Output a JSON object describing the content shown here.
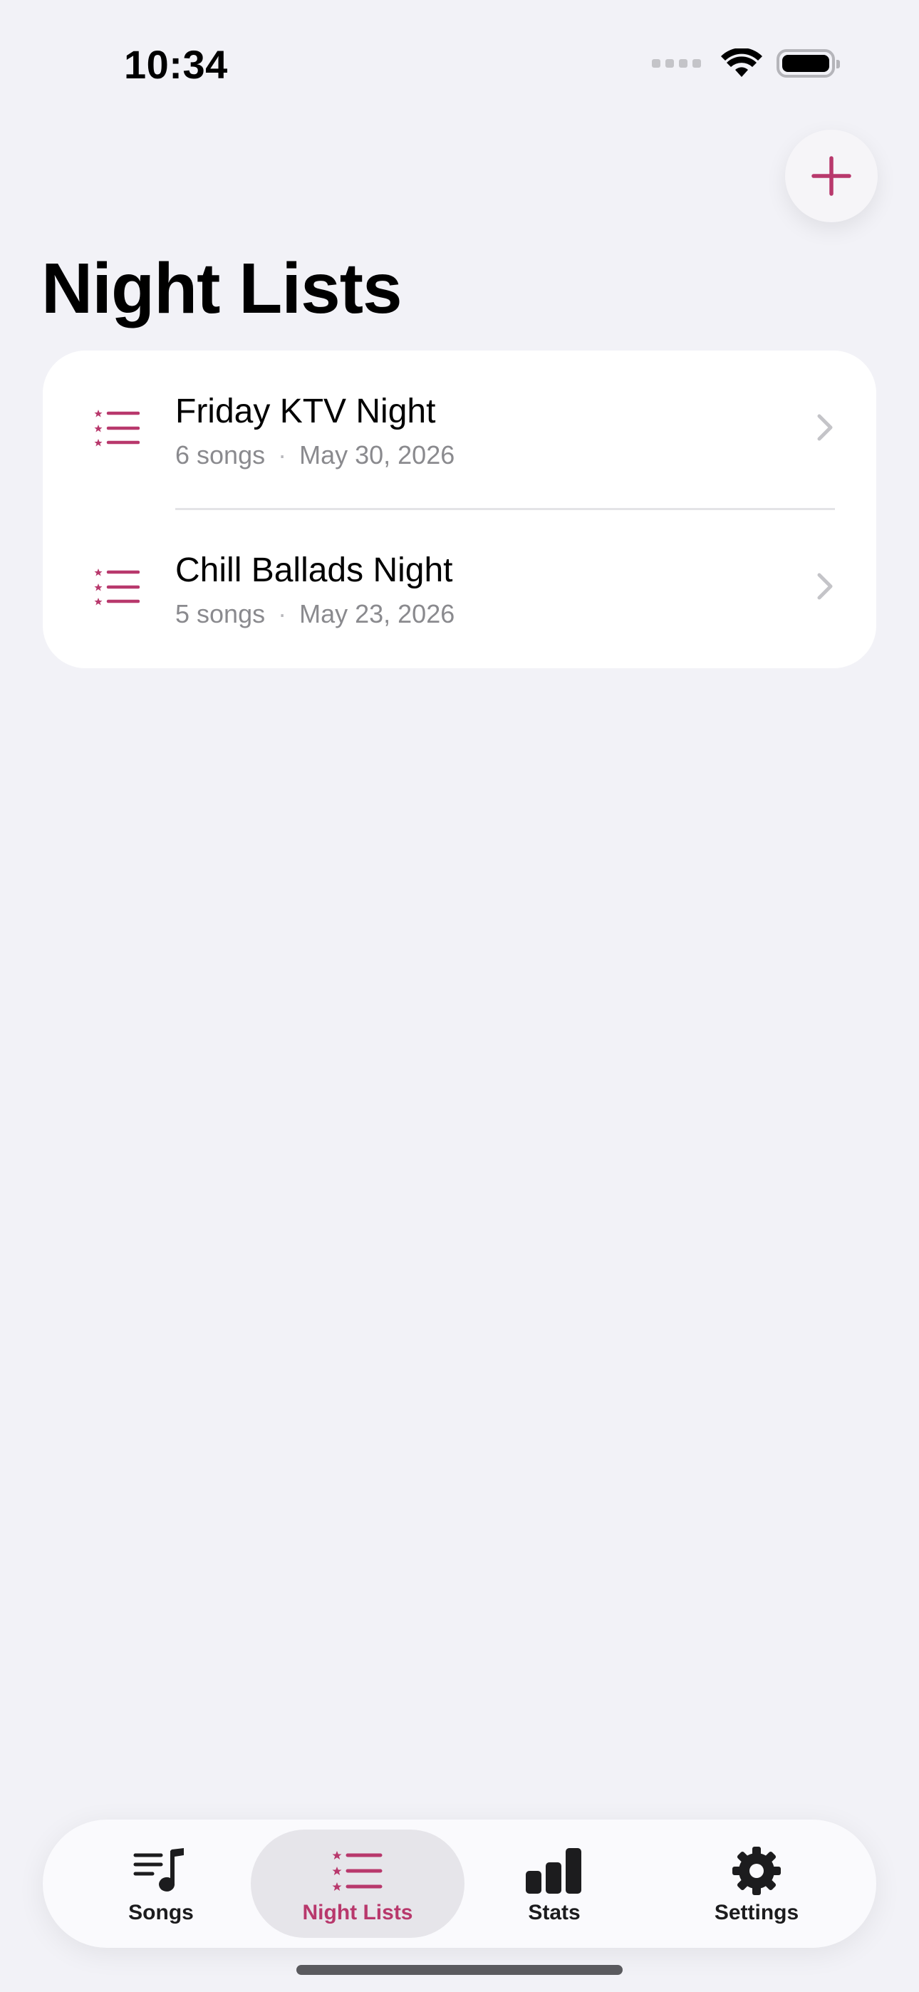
{
  "status_bar": {
    "time": "10:34"
  },
  "header": {
    "title": "Night Lists",
    "add_icon": "plus-icon"
  },
  "lists": [
    {
      "title": "Friday KTV Night",
      "songs": "6 songs",
      "separator": "·",
      "date": "May 30, 2026",
      "icon": "list-star-icon"
    },
    {
      "title": "Chill Ballads Night",
      "songs": "5 songs",
      "separator": "·",
      "date": "May 23, 2026",
      "icon": "list-star-icon"
    }
  ],
  "tabs": [
    {
      "label": "Songs",
      "icon": "music-list-icon",
      "active": false
    },
    {
      "label": "Night Lists",
      "icon": "list-star-icon",
      "active": true
    },
    {
      "label": "Stats",
      "icon": "bar-chart-icon",
      "active": false
    },
    {
      "label": "Settings",
      "icon": "gear-icon",
      "active": false
    }
  ],
  "colors": {
    "accent": "#b8386c",
    "background": "#f2f2f7",
    "card": "#ffffff",
    "secondary_text": "#8a8a8e"
  }
}
